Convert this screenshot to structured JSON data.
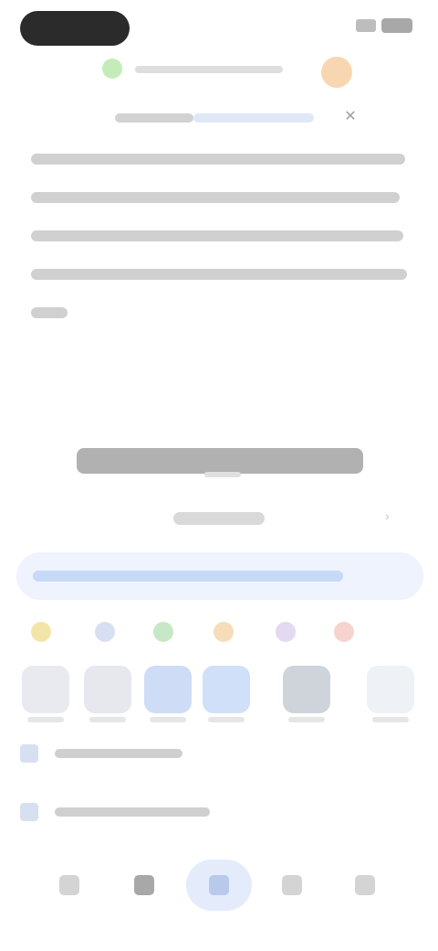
{
  "status_bar": {
    "pill": "",
    "signal_icon": "signal-icon",
    "battery_icon": "battery-icon"
  },
  "browser": {
    "lock_icon": "lock-icon",
    "address": "",
    "avatar": "",
    "tab_title": "",
    "close_icon": "close-icon"
  },
  "article": {
    "paragraph_lines": 5
  },
  "section": {
    "heading": "",
    "subtitle": ""
  },
  "search": {
    "placeholder": ""
  },
  "colors": {
    "dots": [
      "#f3e5a8",
      "#d8dff2",
      "#c7e8c6",
      "#f6dcb8",
      "#e3d9f2",
      "#f6d3cf"
    ],
    "thumbs": [
      "#e8eaf0",
      "#e6e8ee",
      "#cfdcf6",
      "#cfe0f8",
      "#cfd3da",
      "#eef1f6"
    ],
    "accent": "#4c7ee8"
  },
  "list": [
    {
      "icon": "document-icon",
      "label": ""
    },
    {
      "icon": "document-icon",
      "label": ""
    }
  ],
  "nav": [
    {
      "icon": "home-icon",
      "label": ""
    },
    {
      "icon": "apps-icon",
      "label": ""
    },
    {
      "icon": "search-icon",
      "label": ""
    },
    {
      "icon": "bookmark-icon",
      "label": ""
    },
    {
      "icon": "profile-icon",
      "label": ""
    }
  ]
}
